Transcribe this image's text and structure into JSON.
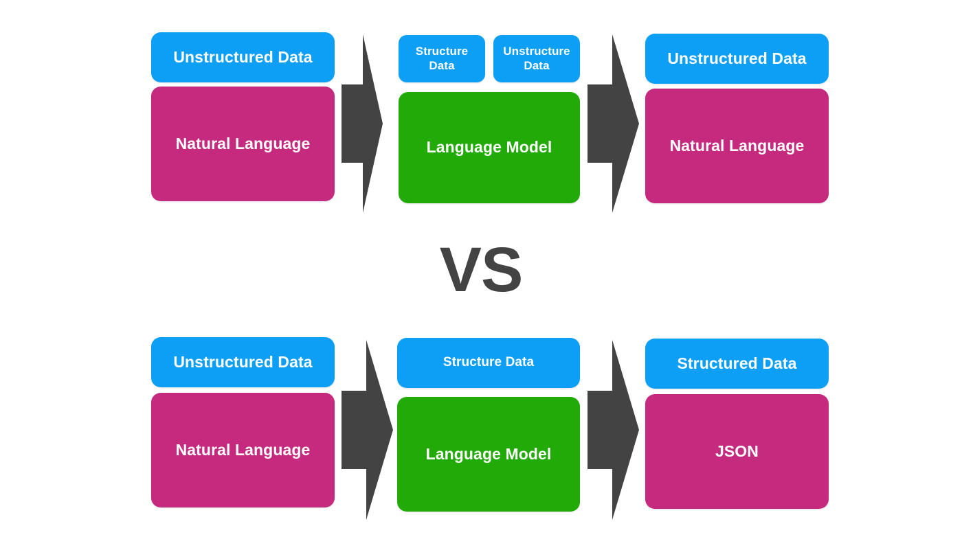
{
  "meta": {
    "background_color": "#FFFFFF"
  },
  "colors": {
    "blue": "#0C9FF5",
    "pink": "#C62A7E",
    "green": "#22AA08",
    "arrow_gray": "#434343",
    "text_on_box": "#FFFFFF"
  },
  "separator": {
    "label": "VS"
  },
  "top_row": {
    "name": "unstructured-output-pipeline",
    "input_stage": {
      "header_label": "Unstructured Data",
      "body_label": "Natural Language"
    },
    "arrow_1": {
      "icon": "right-arrow-icon"
    },
    "model_stage": {
      "header_label_left": "Structure Data",
      "header_label_right": "Unstructure Data",
      "body_label": "Language Model"
    },
    "arrow_2": {
      "icon": "right-arrow-icon"
    },
    "output_stage": {
      "header_label": "Unstructured Data",
      "body_label": "Natural Language"
    }
  },
  "bottom_row": {
    "name": "structured-output-pipeline",
    "input_stage": {
      "header_label": "Unstructured Data",
      "body_label": "Natural Language"
    },
    "arrow_1": {
      "icon": "right-arrow-icon"
    },
    "model_stage": {
      "header_label": "Structure Data",
      "body_label": "Language Model"
    },
    "arrow_2": {
      "icon": "right-arrow-icon"
    },
    "output_stage": {
      "header_label": "Structured Data",
      "body_label": "JSON"
    }
  }
}
